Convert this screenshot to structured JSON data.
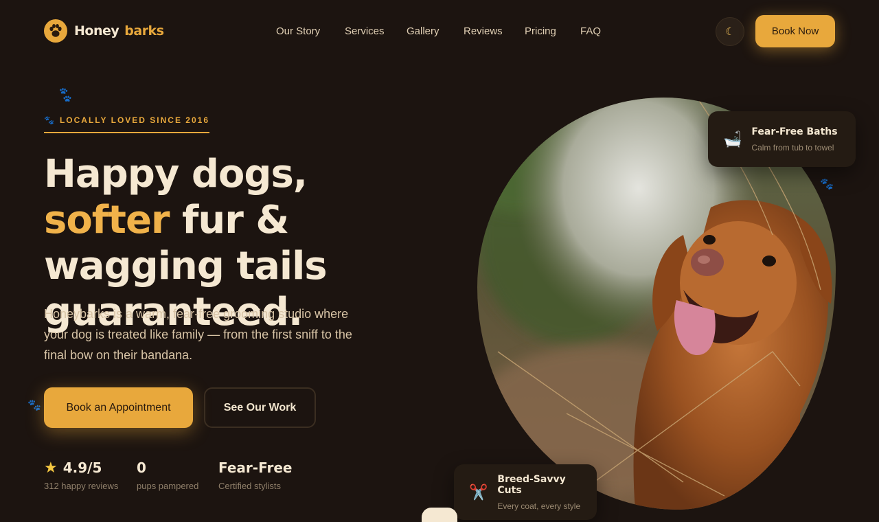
{
  "brand": {
    "name_part1": "Honey",
    "name_part2": "barks"
  },
  "nav": {
    "links": [
      "Our Story",
      "Services",
      "Gallery",
      "Reviews",
      "Pricing",
      "FAQ"
    ],
    "theme_icon": "moon-icon",
    "book_label": "Book Now"
  },
  "hero": {
    "eyebrow": "LOCALLY LOVED SINCE 2016",
    "headline_part1": "Happy dogs, ",
    "headline_accent": "softer",
    "headline_part2": "fur & wagging tails guaranteed.",
    "lead": "Honeybarks is a warm, fear-free grooming studio where your dog is treated like family — from the first sniff to the final bow on their bandana.",
    "cta_primary": "Book an Appointment",
    "cta_secondary": "See Our Work"
  },
  "stats": [
    {
      "value": "4.9/5",
      "label": "312 happy reviews",
      "icon": "star-icon"
    },
    {
      "value": "0",
      "label": "pups pampered"
    },
    {
      "value": "Fear-Free",
      "label": "Certified stylists"
    }
  ],
  "cards": {
    "baths": {
      "title": "Fear-Free Baths",
      "subtitle": "Calm from tub to towel",
      "icon": "bathtub-icon"
    },
    "cuts": {
      "title": "Breed-Savvy Cuts",
      "subtitle": "Every coat, every style",
      "icon": "scissors-icon"
    }
  },
  "colors": {
    "background": "#1c1410",
    "accent": "#e8a83c",
    "text": "#f5e8d2"
  }
}
